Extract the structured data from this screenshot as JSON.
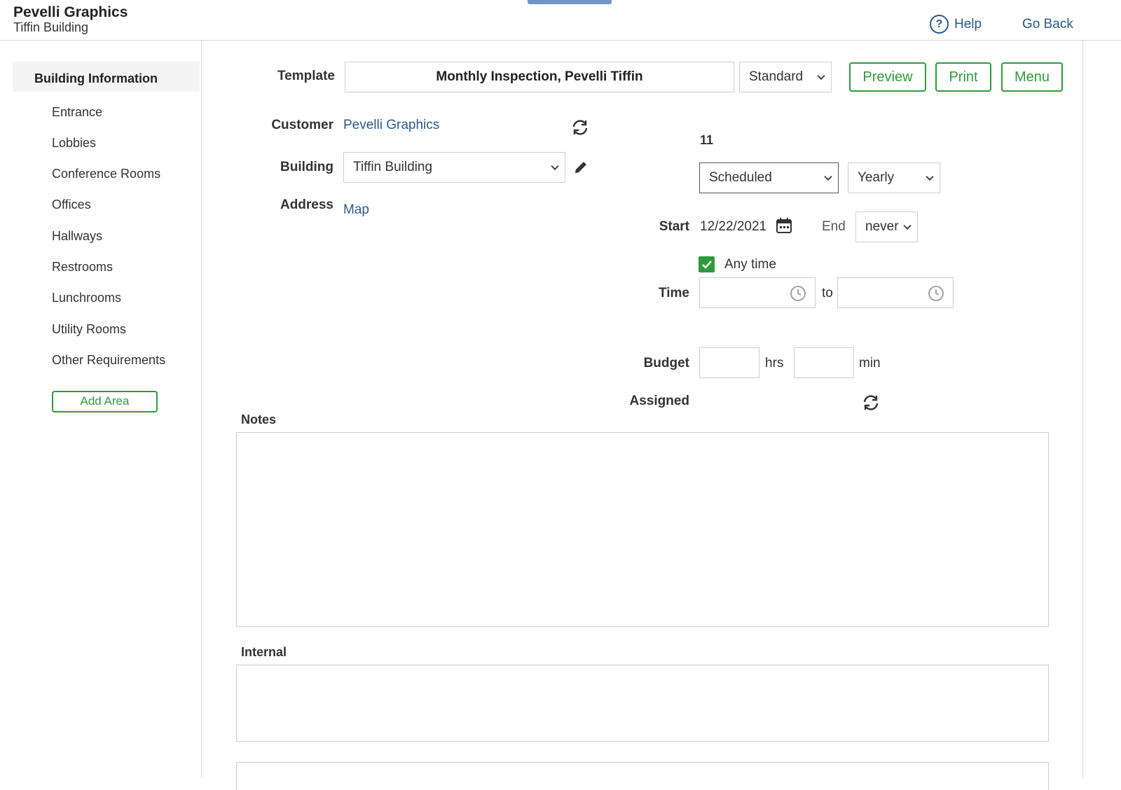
{
  "header": {
    "title": "Pevelli Graphics",
    "subtitle": "Tiffin Building",
    "help_label": "Help",
    "go_back_label": "Go Back"
  },
  "sidebar": {
    "header": "Building Information",
    "items": [
      {
        "label": "Entrance"
      },
      {
        "label": "Lobbies"
      },
      {
        "label": "Conference Rooms"
      },
      {
        "label": "Offices"
      },
      {
        "label": "Hallways"
      },
      {
        "label": "Restrooms"
      },
      {
        "label": "Lunchrooms"
      },
      {
        "label": "Utility Rooms"
      },
      {
        "label": "Other Requirements"
      }
    ],
    "add_area_label": "Add Area"
  },
  "form": {
    "template_label": "Template",
    "template_value": "Monthly Inspection, Pevelli Tiffin",
    "template_type": "Standard",
    "preview_label": "Preview",
    "print_label": "Print",
    "menu_label": "Menu",
    "customer_label": "Customer",
    "customer_value": "Pevelli Graphics",
    "building_label": "Building",
    "building_value": "Tiffin Building",
    "address_label": "Address",
    "map_label": "Map",
    "number_value": "11",
    "status_value": "Scheduled",
    "frequency_value": "Yearly",
    "start_label": "Start",
    "start_date": "12/22/2021",
    "end_label": "End",
    "end_value": "never",
    "any_time_label": "Any time",
    "any_time_checked": true,
    "time_label": "Time",
    "time_from": "",
    "time_to_label": "to",
    "time_to": "",
    "budget_label": "Budget",
    "budget_hrs": "",
    "hrs_label": "hrs",
    "budget_min": "",
    "min_label": "min",
    "assigned_label": "Assigned",
    "notes_label": "Notes",
    "notes_value": "",
    "internal_label": "Internal",
    "internal_value": ""
  },
  "colors": {
    "accent_green": "#2e9a3c",
    "link_blue": "#2a5a8c",
    "top_accent": "#6f95c4"
  }
}
